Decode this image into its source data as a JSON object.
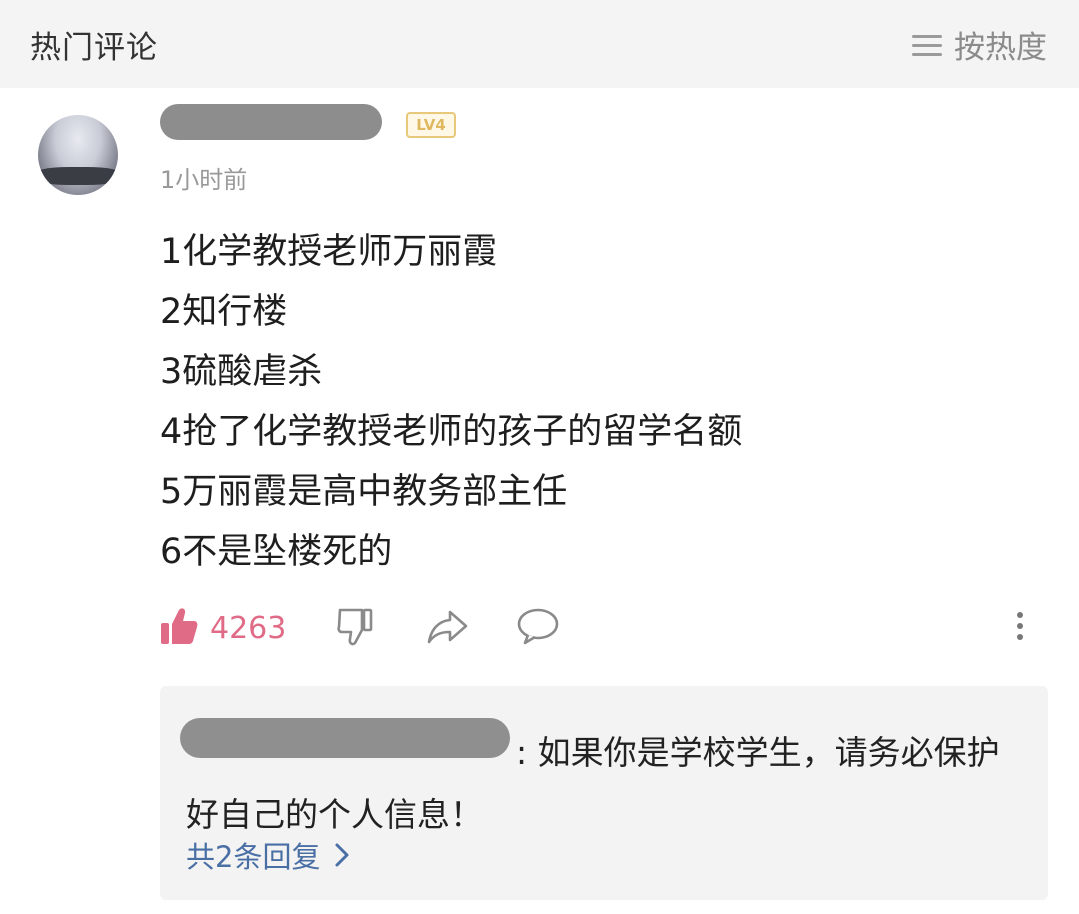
{
  "header": {
    "title": "热门评论",
    "sort_label": "按热度"
  },
  "comment": {
    "username": "",
    "level_badge": "LV4",
    "time": "1小时前",
    "lines": [
      "1化学教授老师万丽霞",
      "2知行楼",
      "3硫酸虐杀",
      "4抢了化学教授老师的孩子的留学名额",
      "5万丽霞是高中教务部主任",
      "6不是坠楼死的"
    ],
    "like_count": "4263"
  },
  "reply": {
    "author": "",
    "text": ": 如果你是学校学生，请务必保护好自己的个人信息！",
    "more_label": "共2条回复"
  },
  "colors": {
    "like": "#e06b86",
    "link": "#4a6fa5",
    "badge": "#e0b860"
  }
}
